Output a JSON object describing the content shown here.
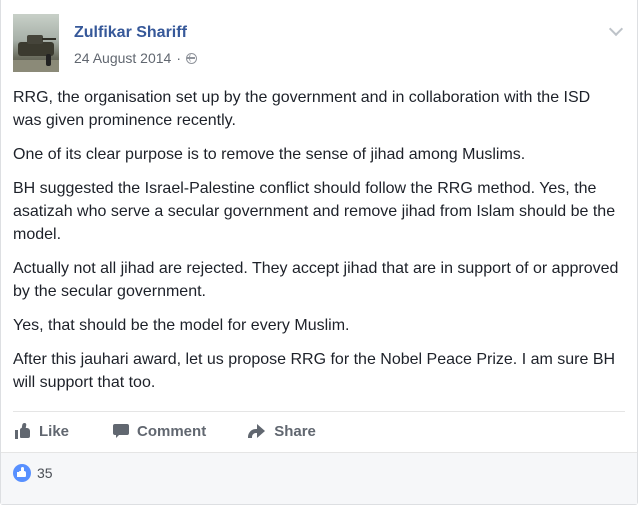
{
  "post": {
    "author": "Zulfikar Shariff",
    "date": "24 August 2014",
    "separator": "·",
    "audience_icon": "globe-icon",
    "menu_icon": "chevron-down-icon",
    "paragraphs": [
      "RRG, the organisation set up by the government and in collaboration with the ISD was given prominence recently.",
      "One of its clear purpose is to remove the sense of jihad among Muslims.",
      "BH suggested the Israel-Palestine conflict should follow the RRG method. Yes, the asatizah who serve a secular government and remove jihad from Islam should be the model.",
      "Actually not all jihad are rejected. They accept jihad that are in support of or approved by the secular government.",
      "Yes, that should be the model for every Muslim.",
      "After this jauhari award, let us propose RRG for the Nobel Peace Prize. I am sure BH will support that too."
    ]
  },
  "actions": {
    "like_label": "Like",
    "comment_label": "Comment",
    "share_label": "Share"
  },
  "reactions": {
    "count": "35",
    "icon": "like-reaction-icon"
  },
  "colors": {
    "author_link": "#365899",
    "secondary_text": "#616770",
    "like_blue": "#5890ff"
  }
}
